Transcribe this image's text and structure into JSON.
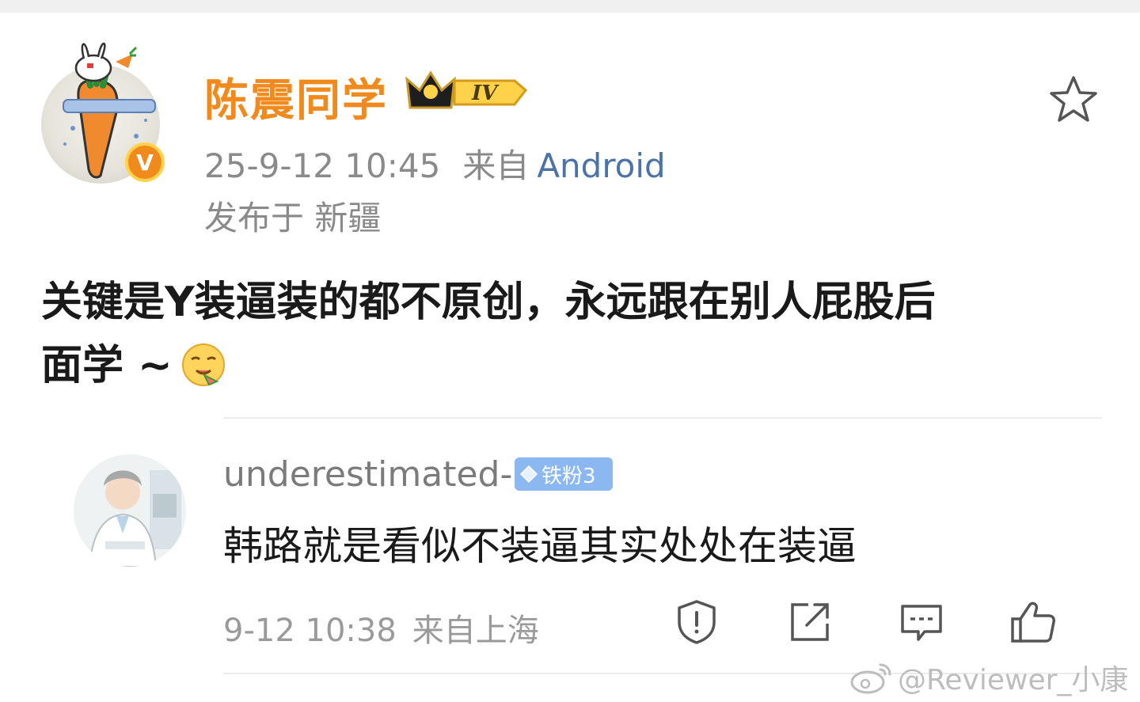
{
  "post": {
    "username": "陈震同学",
    "level_badge": "IV",
    "timestamp": "25-9-12 10:45",
    "from_label": "来自",
    "source": "Android",
    "location": "发布于 新疆",
    "content_line1": "关键是Y装逼装的都不原创，永远跟在别人屁股后",
    "content_line2": "面学 ~",
    "verified_badge": "V",
    "icons": {
      "favorite": "star-icon",
      "emoji": "yum-emoji-icon"
    }
  },
  "comment": {
    "username": "underestimated-",
    "fan_badge": "铁粉3",
    "text": "韩路就是看似不装逼其实处处在装逼",
    "timestamp": "9-12 10:38",
    "location": "来自上海",
    "actions": [
      "report-icon",
      "share-icon",
      "reply-icon",
      "like-icon"
    ]
  },
  "watermark": "@Reviewer_小康",
  "colors": {
    "username": "#f08a1c",
    "source_link": "#4a73a8",
    "meta": "#8a8a8a",
    "fan_badge": "#8bb8f0"
  }
}
